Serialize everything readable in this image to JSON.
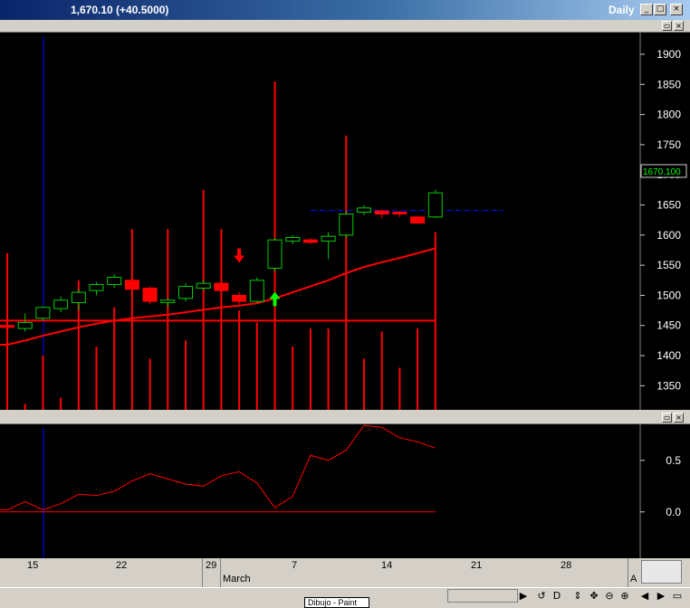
{
  "window": {
    "title": "1,670.10 (+40.5000)",
    "period": "Daily",
    "buttons": [
      "_",
      "□",
      "×"
    ]
  },
  "pane_buttons": [
    "▭",
    "×"
  ],
  "chart_data": [
    {
      "type": "candlestick",
      "y_ticks": [
        "1900",
        "1850",
        "1800",
        "1750",
        "1700",
        "1650",
        "1600",
        "1550",
        "1500",
        "1450",
        "1400",
        "1350"
      ],
      "ylim": [
        1310,
        1930
      ],
      "last_price_label": "1670.100",
      "last_price": 1670.1,
      "dashed_level": 1641,
      "colors": {
        "up": "#00cc00",
        "down": "#ff0000",
        "ma": "#ff0000",
        "volume": "#ff0000",
        "dashed": "#0000ff",
        "background": "#000000"
      },
      "candles": [
        {
          "o": 1450,
          "h": 1452,
          "l": 1446,
          "c": 1448
        },
        {
          "o": 1445,
          "h": 1470,
          "l": 1440,
          "c": 1455
        },
        {
          "o": 1462,
          "h": 1482,
          "l": 1458,
          "c": 1480
        },
        {
          "o": 1478,
          "h": 1498,
          "l": 1472,
          "c": 1492
        },
        {
          "o": 1488,
          "h": 1510,
          "l": 1475,
          "c": 1505
        },
        {
          "o": 1508,
          "h": 1522,
          "l": 1500,
          "c": 1518
        },
        {
          "o": 1518,
          "h": 1535,
          "l": 1512,
          "c": 1530
        },
        {
          "o": 1525,
          "h": 1528,
          "l": 1505,
          "c": 1510
        },
        {
          "o": 1512,
          "h": 1515,
          "l": 1485,
          "c": 1490
        },
        {
          "o": 1488,
          "h": 1495,
          "l": 1480,
          "c": 1492
        },
        {
          "o": 1495,
          "h": 1520,
          "l": 1490,
          "c": 1515
        },
        {
          "o": 1512,
          "h": 1525,
          "l": 1508,
          "c": 1520
        },
        {
          "o": 1520,
          "h": 1523,
          "l": 1505,
          "c": 1508
        },
        {
          "o": 1500,
          "h": 1506,
          "l": 1485,
          "c": 1490
        },
        {
          "o": 1490,
          "h": 1530,
          "l": 1488,
          "c": 1525
        },
        {
          "o": 1545,
          "h": 1595,
          "l": 1540,
          "c": 1592
        },
        {
          "o": 1590,
          "h": 1600,
          "l": 1585,
          "c": 1596
        },
        {
          "o": 1592,
          "h": 1595,
          "l": 1585,
          "c": 1588
        },
        {
          "o": 1590,
          "h": 1605,
          "l": 1560,
          "c": 1598
        },
        {
          "o": 1600,
          "h": 1640,
          "l": 1595,
          "c": 1635
        },
        {
          "o": 1638,
          "h": 1650,
          "l": 1633,
          "c": 1645
        },
        {
          "o": 1640,
          "h": 1642,
          "l": 1628,
          "c": 1635
        },
        {
          "o": 1638,
          "h": 1640,
          "l": 1630,
          "c": 1636
        },
        {
          "o": 1630,
          "h": 1632,
          "l": 1618,
          "c": 1620
        },
        {
          "o": 1630,
          "h": 1675,
          "l": 1628,
          "c": 1670
        }
      ],
      "moving_average": [
        1418,
        1425,
        1433,
        1440,
        1447,
        1453,
        1458,
        1462,
        1465,
        1468,
        1472,
        1476,
        1480,
        1483,
        1487,
        1495,
        1505,
        1515,
        1525,
        1537,
        1547,
        1555,
        1562,
        1570,
        1578
      ],
      "volume_tops": [
        1570,
        1320,
        1400,
        1330,
        1525,
        1415,
        1480,
        1610,
        1395,
        1610,
        1425,
        1675,
        1610,
        1475,
        1455,
        1855,
        1415,
        1445,
        1445,
        1765,
        1395,
        1440,
        1380,
        1445,
        1605
      ],
      "volume_base_line": 1458,
      "signals": [
        {
          "type": "sell-arrow",
          "index": 13,
          "price": 1560
        },
        {
          "type": "buy-arrow",
          "index": 15,
          "price": 1497
        }
      ]
    },
    {
      "type": "line",
      "y_ticks": [
        "0.5",
        "0.0"
      ],
      "ylim": [
        -0.45,
        0.85
      ],
      "zero_line": 0.0,
      "values": [
        0.02,
        0.1,
        0.02,
        0.08,
        0.17,
        0.16,
        0.2,
        0.3,
        0.37,
        0.32,
        0.27,
        0.25,
        0.35,
        0.39,
        0.28,
        0.04,
        0.15,
        0.55,
        0.5,
        0.6,
        0.84,
        0.82,
        0.72,
        0.68,
        0.62
      ]
    }
  ],
  "x_axis": {
    "ticks": [
      "15",
      "22",
      "29",
      "7",
      "14",
      "21",
      "28"
    ],
    "month_labels": [
      "March"
    ],
    "right_cut_label": "A"
  },
  "status": {
    "tools": [
      "▶",
      "↺",
      "D",
      "⇕",
      "✥",
      "⊖",
      "⊕",
      "◀",
      "▶",
      "▭"
    ],
    "taskbar_label": "Dibujo - Paint"
  }
}
